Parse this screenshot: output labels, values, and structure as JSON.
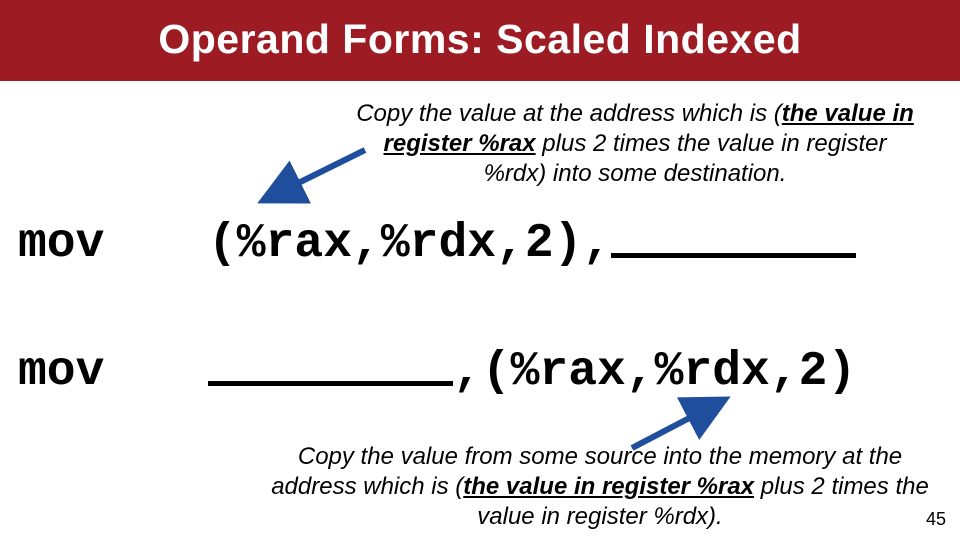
{
  "title": "Operand Forms: Scaled Indexed",
  "caption_top_parts": {
    "pre": "Copy the value at the address which is (",
    "u1": "the value in register %rax",
    "post": " plus 2 times the value in register %rdx) into some destination."
  },
  "caption_bottom_parts": {
    "pre": "Copy the value from some source into the memory at the address which is (",
    "u1": "the value in register %rax",
    "post": " plus 2 times the value in register %rdx)."
  },
  "rows": {
    "r1": {
      "mnemonic": "mov",
      "left": "(%rax,%rdx,2),",
      "right": ""
    },
    "r2": {
      "mnemonic": "mov",
      "left": "",
      "mid_comma": ",",
      "right": "(%rax,%rdx,2)"
    }
  },
  "arrow_color": "#1e4e9c",
  "page_number": "45"
}
